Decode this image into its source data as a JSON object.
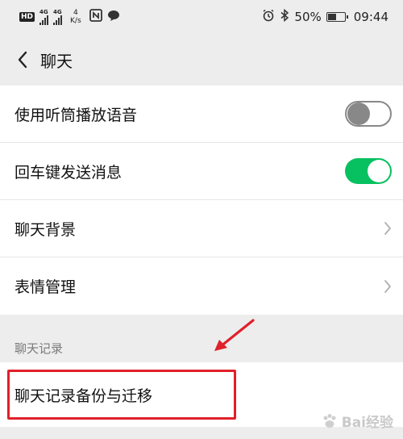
{
  "status_bar": {
    "hd": "HD",
    "net1": "4G",
    "net2": "4G",
    "speed_value": "4",
    "speed_unit": "K/s",
    "battery": "50%",
    "time": "09:44"
  },
  "title_bar": {
    "title": "聊天"
  },
  "settings": {
    "earpiece": {
      "label": "使用听筒播放语音",
      "enabled": false
    },
    "enter_send": {
      "label": "回车键发送消息",
      "enabled": true
    },
    "background": {
      "label": "聊天背景"
    },
    "stickers": {
      "label": "表情管理"
    }
  },
  "section": {
    "header": "聊天记录",
    "backup": {
      "label": "聊天记录备份与迁移"
    }
  },
  "colors": {
    "accent_green": "#07c160",
    "highlight_red": "#e0202a"
  },
  "watermark": {
    "text": "Bai经验"
  }
}
